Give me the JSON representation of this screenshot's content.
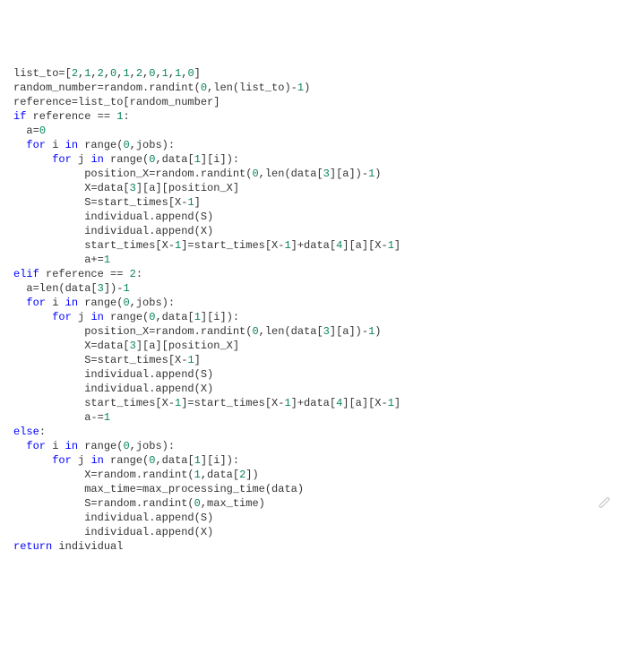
{
  "code": {
    "lines": [
      "list_to=[2,1,2,0,1,2,0,1,1,0]",
      "random_number=random.randint(0,len(list_to)-1)",
      "reference=list_to[random_number]",
      "if reference == 1:",
      "  a=0",
      "  for i in range(0,jobs):",
      "      for j in range(0,data[1][i]):",
      "           position_X=random.randint(0,len(data[3][a])-1)",
      "           X=data[3][a][position_X]",
      "           S=start_times[X-1]",
      "           individual.append(S)",
      "           individual.append(X)",
      "           start_times[X-1]=start_times[X-1]+data[4][a][X-1]",
      "           a+=1",
      "elif reference == 2:",
      "  a=len(data[3])-1",
      "  for i in range(0,jobs):",
      "      for j in range(0,data[1][i]):",
      "           position_X=random.randint(0,len(data[3][a])-1)",
      "           X=data[3][a][position_X]",
      "           S=start_times[X-1]",
      "           individual.append(S)",
      "           individual.append(X)",
      "           start_times[X-1]=start_times[X-1]+data[4][a][X-1]",
      "           a-=1",
      "else:",
      "  for i in range(0,jobs):",
      "      for j in range(0,data[1][i]):",
      "           X=random.randint(1,data[2])",
      "           max_time=max_processing_time(data)",
      "           S=random.randint(0,max_time)",
      "           individual.append(S)",
      "           individual.append(X)",
      "return individual"
    ]
  },
  "icons": {
    "edit": "pencil-icon"
  }
}
